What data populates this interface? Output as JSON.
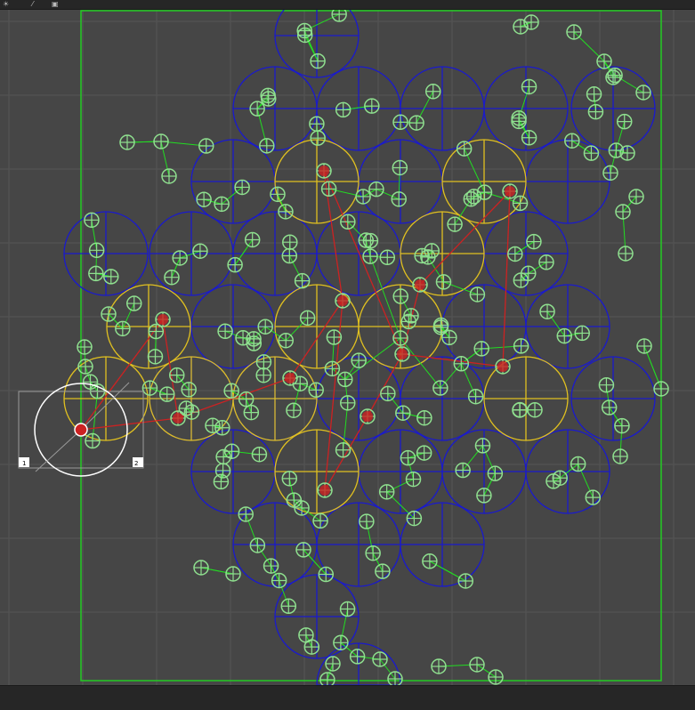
{
  "toolbar": {
    "icons": [
      "sun-icon",
      "brush-icon",
      "square-icon"
    ]
  },
  "gizmo": {
    "left_label": "1",
    "right_label": "2"
  },
  "colors": {
    "background": "#464646",
    "grid": "#555555",
    "boundary": "#22cc22",
    "blue_cell": "#1a1acc",
    "yellow_cell": "#e0c020",
    "node": "#8fe08f",
    "edge": "#22dd22",
    "red_path": "#cc2222",
    "gizmo": "#ffffff"
  }
}
